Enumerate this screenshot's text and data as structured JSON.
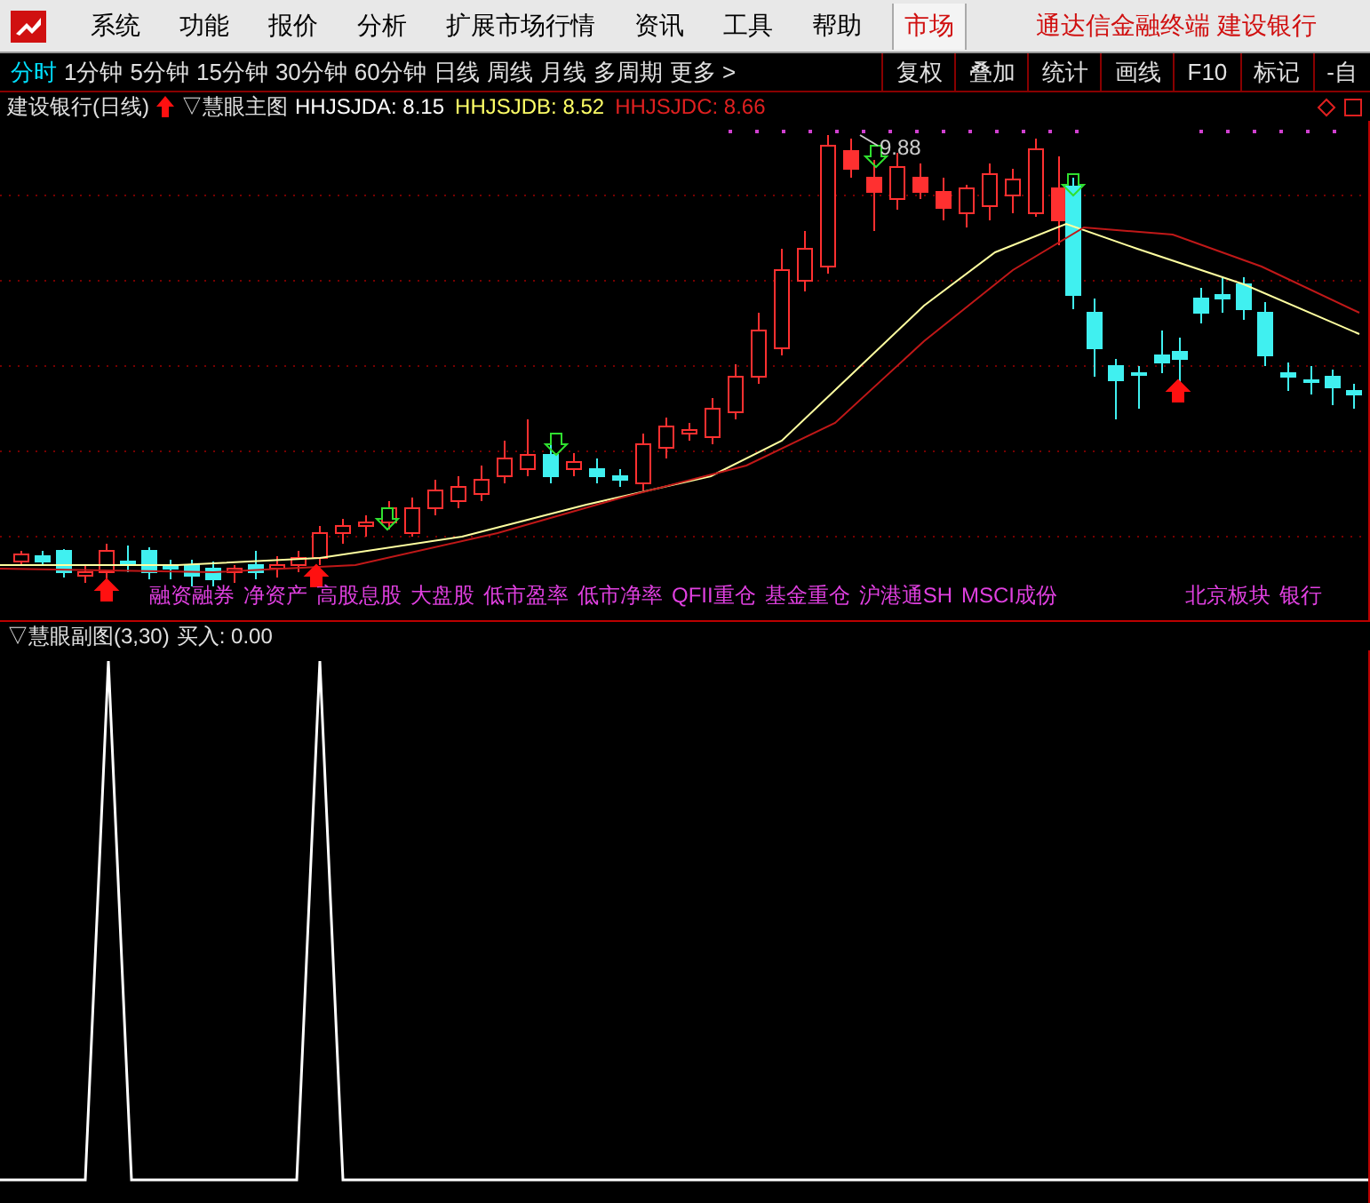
{
  "menu_bar": {
    "items": [
      "系统",
      "功能",
      "报价",
      "分析",
      "扩展市场行情",
      "资讯",
      "工具",
      "帮助"
    ],
    "market_button": "市场",
    "title": "通达信金融终端 建设银行"
  },
  "period_bar": {
    "periods": [
      {
        "label": "分时",
        "selected": true
      },
      {
        "label": "1分钟",
        "selected": false
      },
      {
        "label": "5分钟",
        "selected": false
      },
      {
        "label": "15分钟",
        "selected": false
      },
      {
        "label": "30分钟",
        "selected": false
      },
      {
        "label": "60分钟",
        "selected": false
      },
      {
        "label": "日线",
        "selected": false
      },
      {
        "label": "周线",
        "selected": false
      },
      {
        "label": "月线",
        "selected": false
      },
      {
        "label": "多周期",
        "selected": false
      },
      {
        "label": "更多 >",
        "selected": false
      }
    ],
    "tools": [
      "复权",
      "叠加",
      "统计",
      "画线",
      "F10",
      "标记",
      "-自"
    ]
  },
  "main_chart": {
    "stock": "建设银行(日线)",
    "indicator": "▽慧眼主图",
    "values": [
      {
        "text": "HHJSJDA: 8.15",
        "color": "#ffffff"
      },
      {
        "text": "HHJSJDB: 8.52",
        "color": "#ffff66"
      },
      {
        "text": "HHJSJDC: 8.66",
        "color": "#e02020"
      }
    ],
    "high_label": "9.88",
    "tags": [
      "融资融券",
      "净资产",
      "高股息股",
      "大盘股",
      "低市盈率",
      "低市净率",
      "QFII重仓",
      "基金重仓",
      "沪港通SH",
      "MSCI成份"
    ],
    "region_tags": [
      "北京板块",
      "银行"
    ]
  },
  "sub_chart": {
    "indicator": "▽慧眼副图(3,30)",
    "reading": "买入: 0.00"
  }
}
